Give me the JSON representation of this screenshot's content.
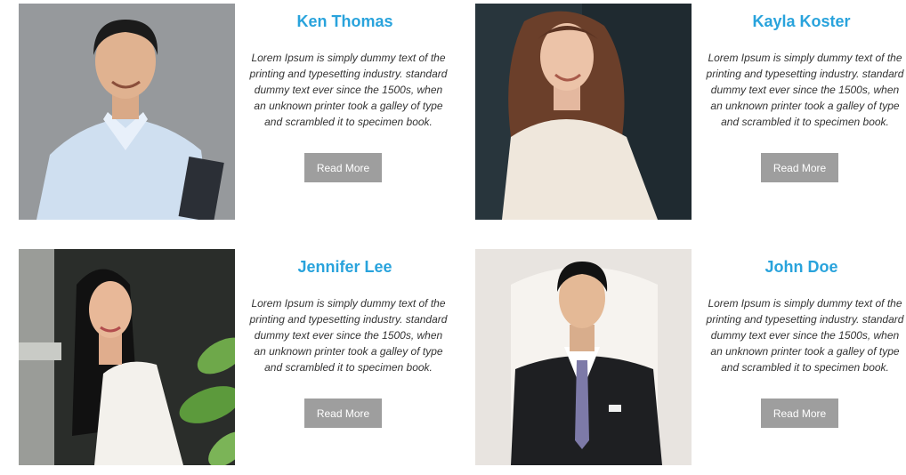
{
  "profiles": [
    {
      "name": "Ken Thomas",
      "bio": "Lorem Ipsum is simply dummy text of the printing and typesetting industry. standard dummy text ever since the 1500s, when an unknown printer took a galley of type and scrambled it to specimen book.",
      "button": "Read More"
    },
    {
      "name": "Kayla Koster",
      "bio": "Lorem Ipsum is simply dummy text of the printing and typesetting industry. standard dummy text ever since the 1500s, when an unknown printer took a galley of type and scrambled it to specimen book.",
      "button": "Read More"
    },
    {
      "name": "Jennifer Lee",
      "bio": "Lorem Ipsum is simply dummy text of the printing and typesetting industry. standard dummy text ever since the 1500s, when an unknown printer took a galley of type and scrambled it to specimen book.",
      "button": "Read More"
    },
    {
      "name": "John Doe",
      "bio": "Lorem Ipsum is simply dummy text of the printing and typesetting industry. standard dummy text ever since the 1500s, when an unknown printer took a galley of type and scrambled it to specimen book.",
      "button": "Read More"
    }
  ],
  "colors": {
    "name": "#29a3dc",
    "button_bg": "#9e9e9e",
    "button_text": "#ffffff",
    "bio_text": "#333333"
  }
}
